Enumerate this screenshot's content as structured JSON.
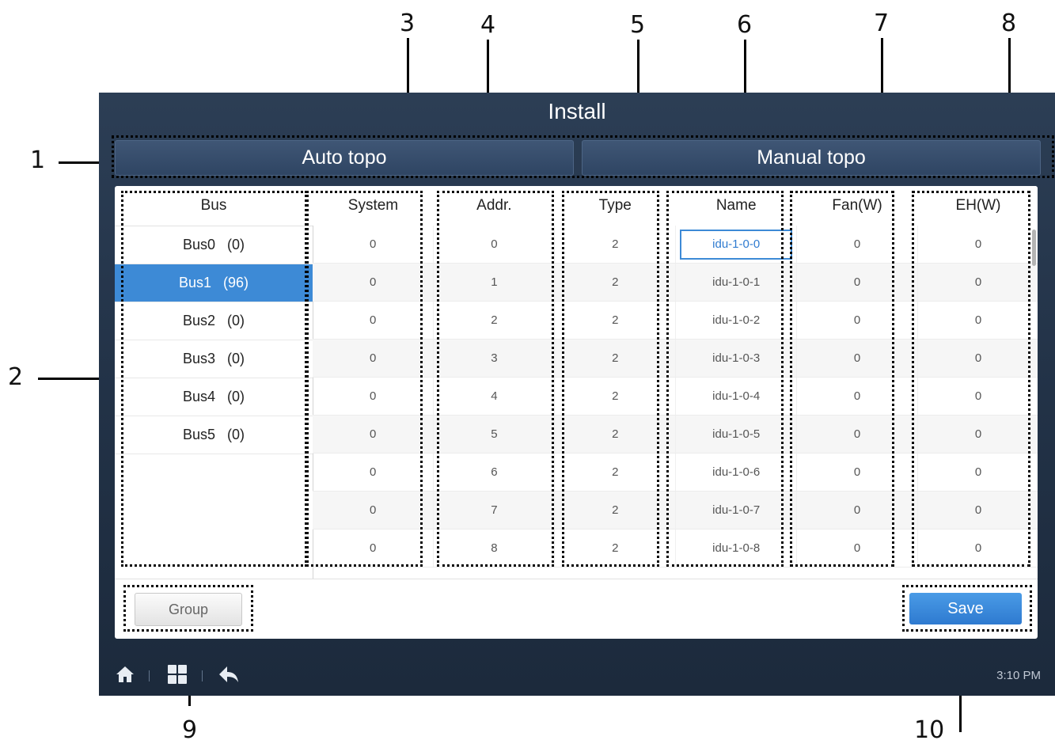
{
  "window": {
    "title": "Install",
    "time": "3:10 PM"
  },
  "tabs": [
    {
      "label": "Auto topo"
    },
    {
      "label": "Manual topo"
    }
  ],
  "bus": {
    "header": "Bus",
    "items": [
      {
        "label": "Bus0   (0)"
      },
      {
        "label": "Bus1   (96)"
      },
      {
        "label": "Bus2   (0)"
      },
      {
        "label": "Bus3   (0)"
      },
      {
        "label": "Bus4   (0)"
      },
      {
        "label": "Bus5   (0)"
      }
    ]
  },
  "table": {
    "columns": [
      "System",
      "Addr.",
      "Type",
      "Name",
      "Fan(W)",
      "EH(W)"
    ],
    "rows": [
      [
        "0",
        "0",
        "2",
        "idu-1-0-0",
        "0",
        "0"
      ],
      [
        "0",
        "1",
        "2",
        "idu-1-0-1",
        "0",
        "0"
      ],
      [
        "0",
        "2",
        "2",
        "idu-1-0-2",
        "0",
        "0"
      ],
      [
        "0",
        "3",
        "2",
        "idu-1-0-3",
        "0",
        "0"
      ],
      [
        "0",
        "4",
        "2",
        "idu-1-0-4",
        "0",
        "0"
      ],
      [
        "0",
        "5",
        "2",
        "idu-1-0-5",
        "0",
        "0"
      ],
      [
        "0",
        "6",
        "2",
        "idu-1-0-6",
        "0",
        "0"
      ],
      [
        "0",
        "7",
        "2",
        "idu-1-0-7",
        "0",
        "0"
      ],
      [
        "0",
        "8",
        "2",
        "idu-1-0-8",
        "0",
        "0"
      ]
    ]
  },
  "buttons": {
    "group": "Group",
    "save": "Save"
  },
  "footer_icons": [
    "home-icon",
    "grid-icon",
    "back-icon"
  ],
  "callouts": [
    "1",
    "2",
    "3",
    "4",
    "5",
    "6",
    "7",
    "8",
    "9",
    "10"
  ]
}
